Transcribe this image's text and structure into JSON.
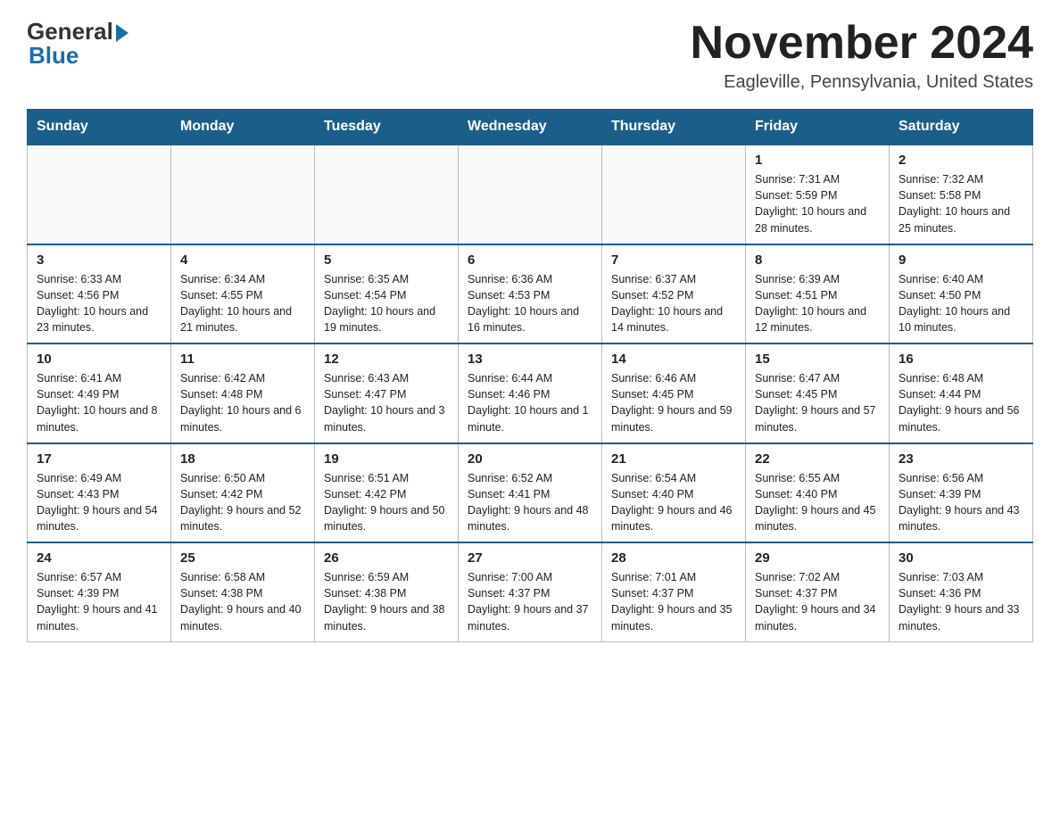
{
  "header": {
    "logo_general": "General",
    "logo_blue": "Blue",
    "title": "November 2024",
    "subtitle": "Eagleville, Pennsylvania, United States"
  },
  "calendar": {
    "days_of_week": [
      "Sunday",
      "Monday",
      "Tuesday",
      "Wednesday",
      "Thursday",
      "Friday",
      "Saturday"
    ],
    "weeks": [
      [
        {
          "day": "",
          "info": ""
        },
        {
          "day": "",
          "info": ""
        },
        {
          "day": "",
          "info": ""
        },
        {
          "day": "",
          "info": ""
        },
        {
          "day": "",
          "info": ""
        },
        {
          "day": "1",
          "info": "Sunrise: 7:31 AM\nSunset: 5:59 PM\nDaylight: 10 hours and 28 minutes."
        },
        {
          "day": "2",
          "info": "Sunrise: 7:32 AM\nSunset: 5:58 PM\nDaylight: 10 hours and 25 minutes."
        }
      ],
      [
        {
          "day": "3",
          "info": "Sunrise: 6:33 AM\nSunset: 4:56 PM\nDaylight: 10 hours and 23 minutes."
        },
        {
          "day": "4",
          "info": "Sunrise: 6:34 AM\nSunset: 4:55 PM\nDaylight: 10 hours and 21 minutes."
        },
        {
          "day": "5",
          "info": "Sunrise: 6:35 AM\nSunset: 4:54 PM\nDaylight: 10 hours and 19 minutes."
        },
        {
          "day": "6",
          "info": "Sunrise: 6:36 AM\nSunset: 4:53 PM\nDaylight: 10 hours and 16 minutes."
        },
        {
          "day": "7",
          "info": "Sunrise: 6:37 AM\nSunset: 4:52 PM\nDaylight: 10 hours and 14 minutes."
        },
        {
          "day": "8",
          "info": "Sunrise: 6:39 AM\nSunset: 4:51 PM\nDaylight: 10 hours and 12 minutes."
        },
        {
          "day": "9",
          "info": "Sunrise: 6:40 AM\nSunset: 4:50 PM\nDaylight: 10 hours and 10 minutes."
        }
      ],
      [
        {
          "day": "10",
          "info": "Sunrise: 6:41 AM\nSunset: 4:49 PM\nDaylight: 10 hours and 8 minutes."
        },
        {
          "day": "11",
          "info": "Sunrise: 6:42 AM\nSunset: 4:48 PM\nDaylight: 10 hours and 6 minutes."
        },
        {
          "day": "12",
          "info": "Sunrise: 6:43 AM\nSunset: 4:47 PM\nDaylight: 10 hours and 3 minutes."
        },
        {
          "day": "13",
          "info": "Sunrise: 6:44 AM\nSunset: 4:46 PM\nDaylight: 10 hours and 1 minute."
        },
        {
          "day": "14",
          "info": "Sunrise: 6:46 AM\nSunset: 4:45 PM\nDaylight: 9 hours and 59 minutes."
        },
        {
          "day": "15",
          "info": "Sunrise: 6:47 AM\nSunset: 4:45 PM\nDaylight: 9 hours and 57 minutes."
        },
        {
          "day": "16",
          "info": "Sunrise: 6:48 AM\nSunset: 4:44 PM\nDaylight: 9 hours and 56 minutes."
        }
      ],
      [
        {
          "day": "17",
          "info": "Sunrise: 6:49 AM\nSunset: 4:43 PM\nDaylight: 9 hours and 54 minutes."
        },
        {
          "day": "18",
          "info": "Sunrise: 6:50 AM\nSunset: 4:42 PM\nDaylight: 9 hours and 52 minutes."
        },
        {
          "day": "19",
          "info": "Sunrise: 6:51 AM\nSunset: 4:42 PM\nDaylight: 9 hours and 50 minutes."
        },
        {
          "day": "20",
          "info": "Sunrise: 6:52 AM\nSunset: 4:41 PM\nDaylight: 9 hours and 48 minutes."
        },
        {
          "day": "21",
          "info": "Sunrise: 6:54 AM\nSunset: 4:40 PM\nDaylight: 9 hours and 46 minutes."
        },
        {
          "day": "22",
          "info": "Sunrise: 6:55 AM\nSunset: 4:40 PM\nDaylight: 9 hours and 45 minutes."
        },
        {
          "day": "23",
          "info": "Sunrise: 6:56 AM\nSunset: 4:39 PM\nDaylight: 9 hours and 43 minutes."
        }
      ],
      [
        {
          "day": "24",
          "info": "Sunrise: 6:57 AM\nSunset: 4:39 PM\nDaylight: 9 hours and 41 minutes."
        },
        {
          "day": "25",
          "info": "Sunrise: 6:58 AM\nSunset: 4:38 PM\nDaylight: 9 hours and 40 minutes."
        },
        {
          "day": "26",
          "info": "Sunrise: 6:59 AM\nSunset: 4:38 PM\nDaylight: 9 hours and 38 minutes."
        },
        {
          "day": "27",
          "info": "Sunrise: 7:00 AM\nSunset: 4:37 PM\nDaylight: 9 hours and 37 minutes."
        },
        {
          "day": "28",
          "info": "Sunrise: 7:01 AM\nSunset: 4:37 PM\nDaylight: 9 hours and 35 minutes."
        },
        {
          "day": "29",
          "info": "Sunrise: 7:02 AM\nSunset: 4:37 PM\nDaylight: 9 hours and 34 minutes."
        },
        {
          "day": "30",
          "info": "Sunrise: 7:03 AM\nSunset: 4:36 PM\nDaylight: 9 hours and 33 minutes."
        }
      ]
    ]
  }
}
